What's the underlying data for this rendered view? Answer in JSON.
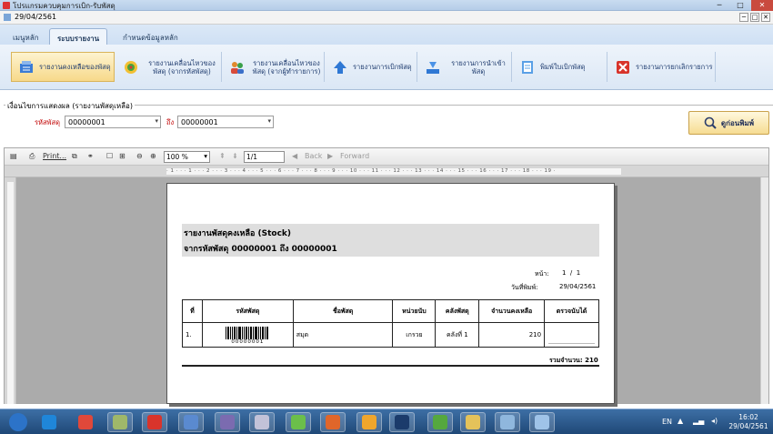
{
  "window": {
    "title": "โปรแกรมควบคุมการเบิก-รับพัสดุ",
    "child_title": "29/04/2561",
    "buttons": [
      "─",
      "□",
      "✕"
    ]
  },
  "ribbon": {
    "tabs": [
      {
        "label": "เมนูหลัก",
        "active": false
      },
      {
        "label": "ระบบรายงาน",
        "active": true
      },
      {
        "label": "กำหนดข้อมูลหลัก",
        "active": false
      }
    ],
    "buttons": [
      {
        "label": "รายงานคงเหลือของพัสดุ",
        "icon": "stock-report-icon",
        "selected": true
      },
      {
        "label": "รายงานเคลื่อนไหวของพัสดุ (จากรหัสพัสดุ)",
        "icon": "movement-code-icon",
        "selected": false
      },
      {
        "label": "รายงานเคลื่อนไหวของพัสดุ (จากผู้ทำรายการ)",
        "icon": "movement-user-icon",
        "selected": false
      },
      {
        "label": "รายงานการเบิกพัสดุ",
        "icon": "withdraw-report-icon",
        "selected": false
      },
      {
        "label": "รายงานการนำเข้าพัสดุ",
        "icon": "import-report-icon",
        "selected": false
      },
      {
        "label": "พิมพ์ใบเบิกพัสดุ",
        "icon": "print-slip-icon",
        "selected": false
      },
      {
        "label": "รายงานการยกเลิกรายการ",
        "icon": "cancel-report-icon",
        "selected": false
      }
    ]
  },
  "filter": {
    "group_label": "เงื่อนไขการแสดงผล (รายงานพัสดุเหลือ)",
    "code_label": "รหัสพัสดุ",
    "from_value": "00000001",
    "to_label": "ถึง",
    "to_value": "00000001",
    "print_button": "ดูก่อนพิมพ์"
  },
  "viewer_toolbar": {
    "print_label": "Print...",
    "zoom": "100 %",
    "page": "1/1",
    "back_label": "Back",
    "forward_label": "Forward"
  },
  "ruler": "· 1 · · · 1 · · · 2 · · · 3 · · · 4 · · · 5 · · · 6 · · · 7 · · · 8 · · · 9 · · · 10 · · · 11 · · · 12 · · · 13 · · · 14 · · · 15 · · · 16 · · · 17 · · · 18 · · · 19 · ",
  "report": {
    "title": "รายงานพัสดุคงเหลือ (Stock)",
    "subtitle": "จากรหัสพัสดุ 00000001  ถึง  00000001",
    "page_label": "หน้า:",
    "page_value": "1  /  1",
    "date_label": "วันที่พิมพ์:",
    "date_value": "29/04/2561",
    "columns": [
      "ที่",
      "รหัสพัสดุ",
      "ชื่อพัสดุ",
      "หน่วยนับ",
      "คลังพัสดุ",
      "จำนวนคงเหลือ",
      "ตรวจนับได้"
    ],
    "rows": [
      {
        "no": "1.",
        "barcode": "00000001",
        "name": "สมุด",
        "unit": "เกรวย",
        "store": "คลังที่ 1",
        "remain": "210"
      }
    ],
    "total_label": "รวมจำนวน: 210"
  },
  "taskbar": {
    "lang": "EN",
    "time": "16:02",
    "date": "29/04/2561",
    "items": [
      {
        "name": "start-button",
        "color": "#2c73c8"
      },
      {
        "name": "ie-taskbar-icon",
        "color": "#1f86d9"
      },
      {
        "name": "chrome-taskbar-icon",
        "color": "#e0483a"
      },
      {
        "name": "app-taskbar-icon-1",
        "color": "#9fb86a"
      },
      {
        "name": "app-taskbar-icon-2",
        "color": "#d9342b"
      },
      {
        "name": "app-taskbar-icon-3",
        "color": "#5a8ad0"
      },
      {
        "name": "app-taskbar-icon-4",
        "color": "#7b6bb0"
      },
      {
        "name": "app-taskbar-icon-5",
        "color": "#c2c2d8"
      },
      {
        "name": "app-taskbar-icon-6",
        "color": "#6bbf4a"
      },
      {
        "name": "fox-taskbar-icon",
        "color": "#e0662a"
      },
      {
        "name": "bird-taskbar-icon",
        "color": "#f0a62c"
      },
      {
        "name": "photoshop-taskbar-icon",
        "color": "#1b3b6b"
      },
      {
        "name": "utorrent-taskbar-icon",
        "color": "#55a83e"
      },
      {
        "name": "explorer-taskbar-icon",
        "color": "#e4c25a"
      },
      {
        "name": "app-taskbar-icon-7",
        "color": "#8fb7dd"
      },
      {
        "name": "app-taskbar-icon-8",
        "color": "#9fc3e8"
      }
    ]
  }
}
